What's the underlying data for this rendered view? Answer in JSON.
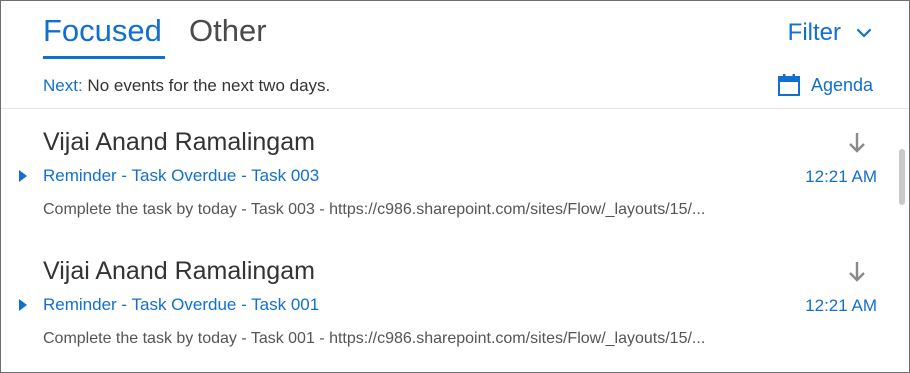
{
  "tabs": {
    "focused": "Focused",
    "other": "Other"
  },
  "filter_label": "Filter",
  "next_bar": {
    "label": "Next:",
    "text": " No events for the next two days."
  },
  "agenda_label": "Agenda",
  "messages": [
    {
      "sender": "Vijai Anand Ramalingam",
      "subject": "Reminder - Task Overdue - Task 003",
      "time": "12:21 AM",
      "preview": "Complete the task by today - Task 003 - https://c986.sharepoint.com/sites/Flow/_layouts/15/..."
    },
    {
      "sender": "Vijai Anand Ramalingam",
      "subject": "Reminder - Task Overdue - Task 001",
      "time": "12:21 AM",
      "preview": "Complete the task by today - Task 001 - https://c986.sharepoint.com/sites/Flow/_layouts/15/..."
    }
  ],
  "colors": {
    "accent": "#1170cf",
    "text": "#333333",
    "muted": "#555555"
  },
  "icons": [
    "chevron-down-icon",
    "calendar-icon",
    "arrow-down-icon",
    "caret-right-icon"
  ]
}
